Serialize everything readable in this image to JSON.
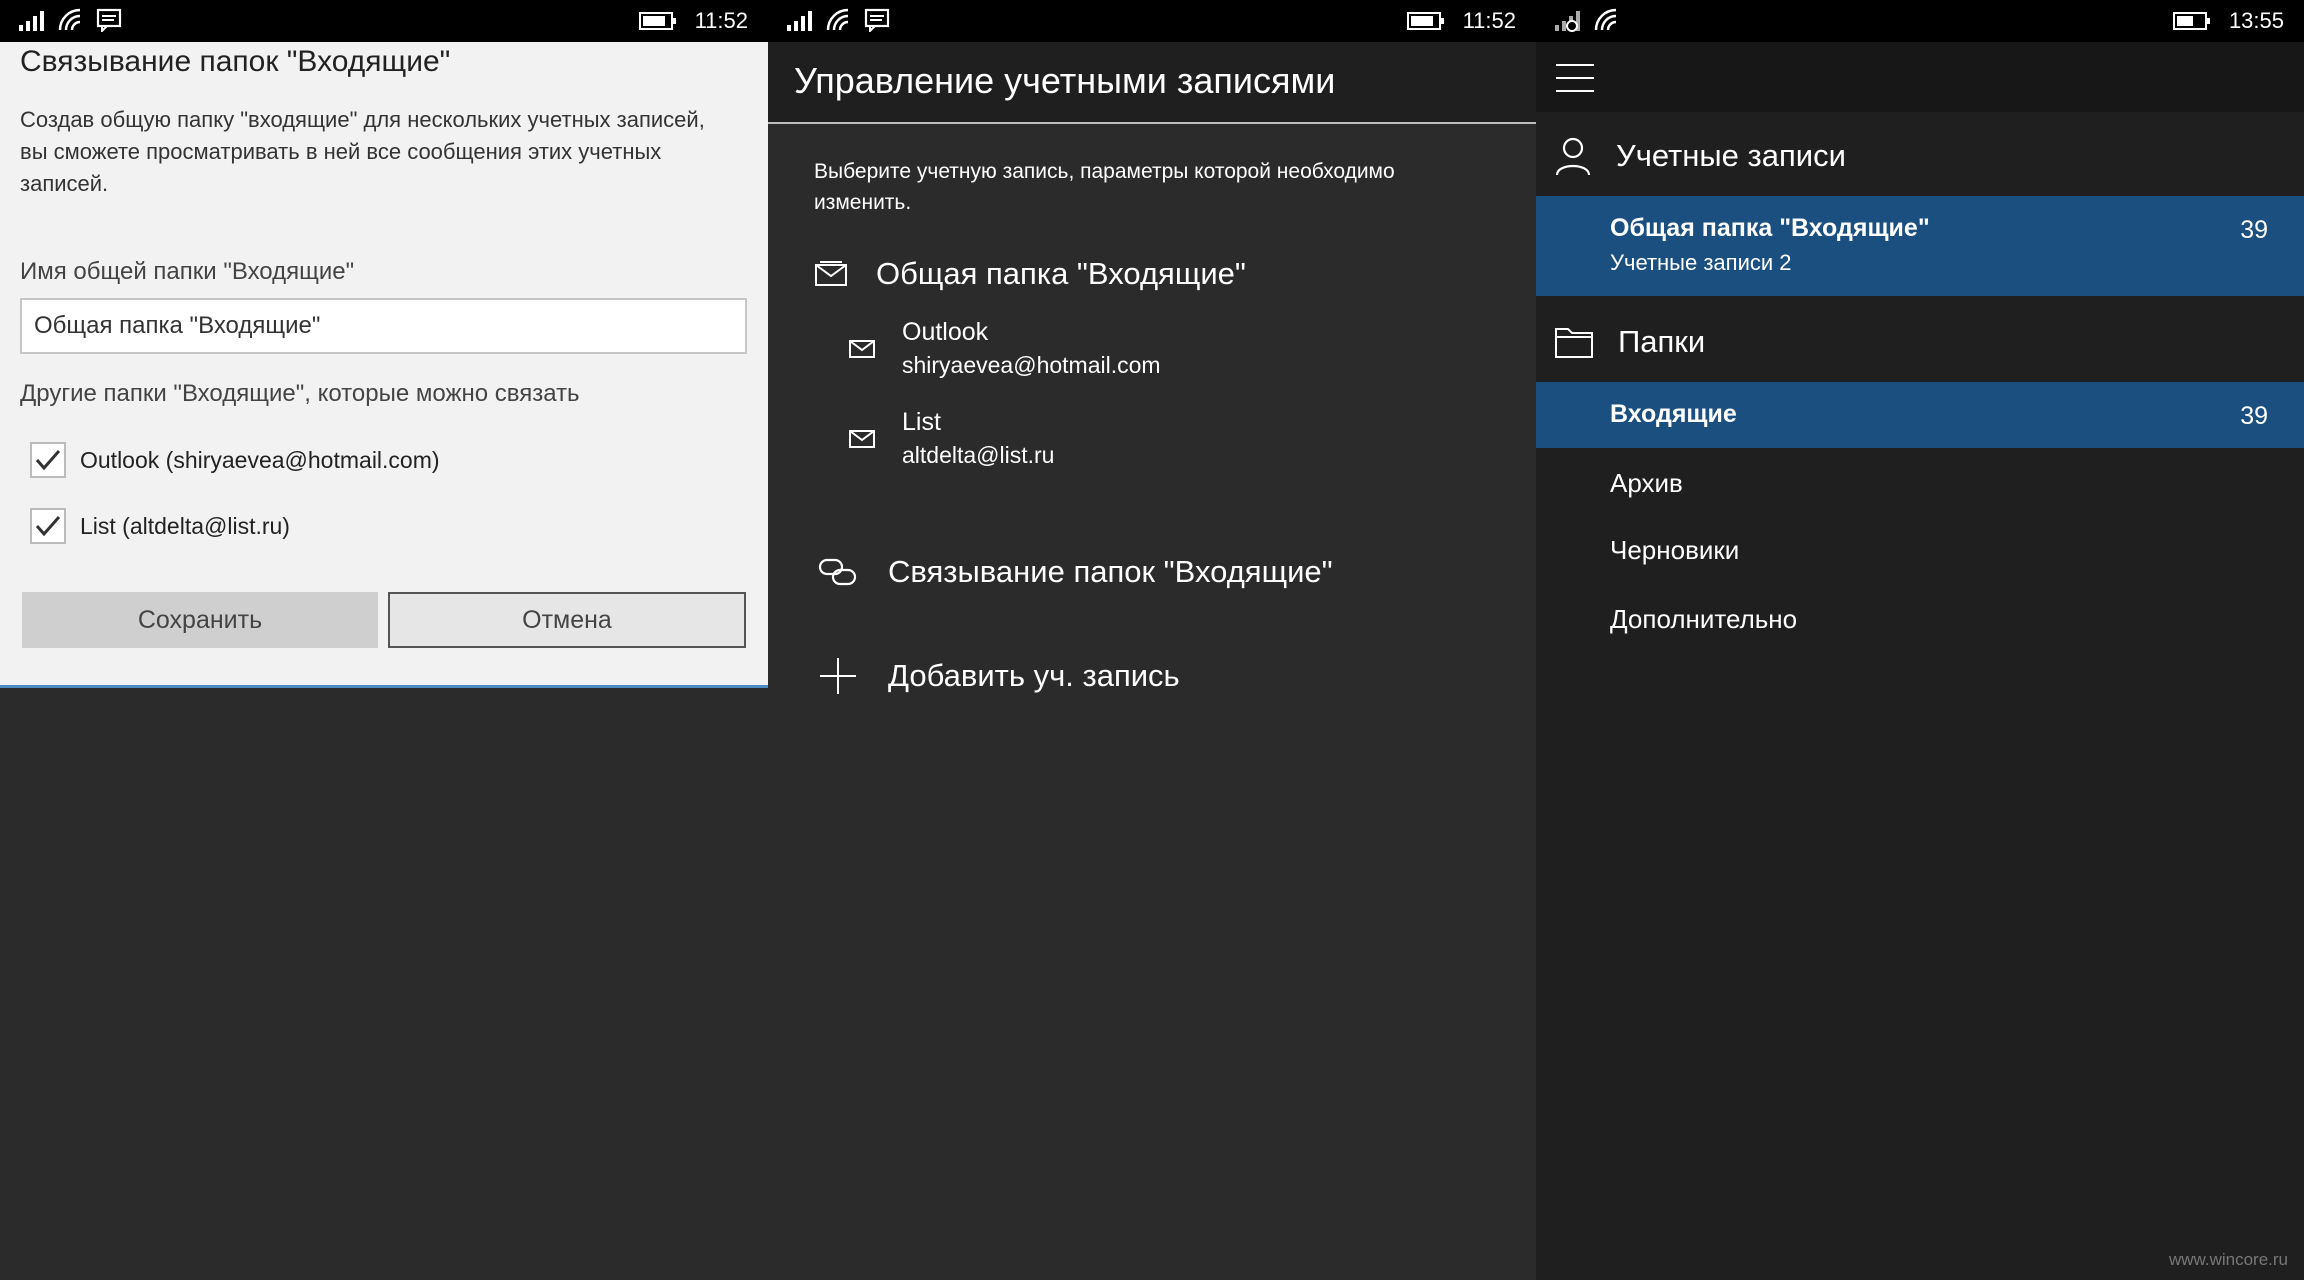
{
  "screens": [
    {
      "status": {
        "time": "11:52"
      },
      "dialog": {
        "title": "Связывание папок \"Входящие\"",
        "description": "Создав общую папку \"входящие\" для нескольких учетных записей, вы сможете просматривать в ней все сообщения этих учетных записей.",
        "name_label": "Имя общей папки \"Входящие\"",
        "name_value": "Общая папка \"Входящие\"",
        "others_label": "Другие папки \"Входящие\", которые можно связать",
        "checkboxes": [
          {
            "label": "Outlook (shiryaevea@hotmail.com)",
            "checked": true
          },
          {
            "label": "List (altdelta@list.ru)",
            "checked": true
          }
        ],
        "save_label": "Сохранить",
        "cancel_label": "Отмена"
      }
    },
    {
      "status": {
        "time": "11:52"
      },
      "header": {
        "title": "Управление учетными записями"
      },
      "description": "Выберите учетную запись, параметры которой необходимо изменить.",
      "linked_inbox": {
        "title": "Общая папка \"Входящие\"",
        "accounts": [
          {
            "name": "Outlook",
            "email": "shiryaevea@hotmail.com"
          },
          {
            "name": "List",
            "email": "altdelta@list.ru"
          }
        ]
      },
      "link_action": "Связывание папок \"Входящие\"",
      "add_action": "Добавить уч. запись"
    },
    {
      "status": {
        "time": "13:55"
      },
      "accounts_header": "Учетные записи",
      "selected_account": {
        "title": "Общая папка \"Входящие\"",
        "subtitle": "Учетные записи 2",
        "count": "39"
      },
      "folders_header": "Папки",
      "folders": [
        {
          "label": "Входящие",
          "count": "39",
          "selected": true
        },
        {
          "label": "Архив"
        },
        {
          "label": "Черновики"
        },
        {
          "label": "Дополнительно"
        }
      ]
    }
  ],
  "watermark": "www.wincore.ru",
  "colors": {
    "accent_selected": "#1b4f80",
    "dialog_bg": "#f2f2f2",
    "dark_bg": "#2b2b2b",
    "statusbar_bg": "#000000"
  }
}
